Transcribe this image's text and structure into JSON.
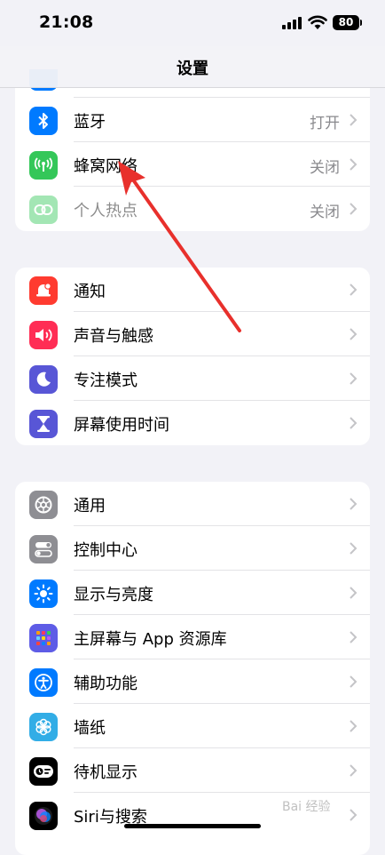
{
  "status": {
    "time": "21:08",
    "battery": "80"
  },
  "nav": {
    "title": "设置"
  },
  "groups": [
    {
      "rows": [
        {
          "label": "蓝牙",
          "value": "打开",
          "icon": "bluetooth-icon",
          "color": "#007aff"
        },
        {
          "label": "蜂窝网络",
          "value": "关闭",
          "icon": "cellular-icon",
          "color": "#34c759"
        },
        {
          "label": "个人热点",
          "value": "关闭",
          "icon": "hotspot-icon",
          "color": "#34c759",
          "dimmed": true
        }
      ]
    },
    {
      "rows": [
        {
          "label": "通知",
          "icon": "notifications-icon",
          "color": "#ff3b30"
        },
        {
          "label": "声音与触感",
          "icon": "sounds-icon",
          "color": "#ff2d55"
        },
        {
          "label": "专注模式",
          "icon": "moon-icon",
          "color": "#5856d6"
        },
        {
          "label": "屏幕使用时间",
          "icon": "hourglass-icon",
          "color": "#5856d6"
        }
      ]
    },
    {
      "rows": [
        {
          "label": "通用",
          "icon": "gear-icon",
          "color": "#8e8e93"
        },
        {
          "label": "控制中心",
          "icon": "toggles-icon",
          "color": "#8e8e93"
        },
        {
          "label": "显示与亮度",
          "icon": "sun-icon",
          "color": "#007aff"
        },
        {
          "label": "主屏幕与 App 资源库",
          "icon": "home-grid-icon",
          "color": "#5e5ce6"
        },
        {
          "label": "辅助功能",
          "icon": "accessibility-icon",
          "color": "#007aff"
        },
        {
          "label": "墙纸",
          "icon": "wallpaper-flower-icon",
          "color": "#32ade6"
        },
        {
          "label": "待机显示",
          "icon": "standby-icon",
          "color": "#000000"
        },
        {
          "label": "Siri与搜索",
          "icon": "siri-icon",
          "color": "#000000"
        }
      ]
    }
  ],
  "watermark": "Bai 经验"
}
